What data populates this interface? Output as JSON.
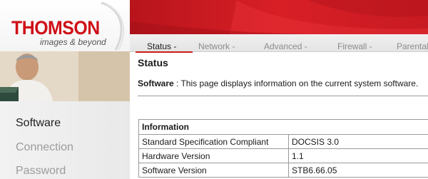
{
  "brand": {
    "name": "THOMSON",
    "tagline": "images & beyond",
    "colors": {
      "primary_red": "#cc1a1a",
      "logo_red": "#cf1018"
    }
  },
  "nav": {
    "items": [
      {
        "label": "Status -",
        "active": true
      },
      {
        "label": "Network -",
        "active": false
      },
      {
        "label": "Advanced -",
        "active": false
      },
      {
        "label": "Firewall -",
        "active": false
      },
      {
        "label": "Parental",
        "active": false
      }
    ]
  },
  "sidebar": {
    "items": [
      {
        "label": "Software",
        "active": true
      },
      {
        "label": "Connection",
        "active": false
      },
      {
        "label": "Password",
        "active": false
      }
    ]
  },
  "main": {
    "title": "Status",
    "description_label": "Software",
    "description_text": " :  This page displays information on the current system software.",
    "table": {
      "header": "Information",
      "rows": [
        {
          "label": "Standard Specification Compliant",
          "value": "DOCSIS 3.0"
        },
        {
          "label": "Hardware Version",
          "value": "1.1"
        },
        {
          "label": "Software Version",
          "value": "STB6.66.05"
        }
      ]
    }
  }
}
